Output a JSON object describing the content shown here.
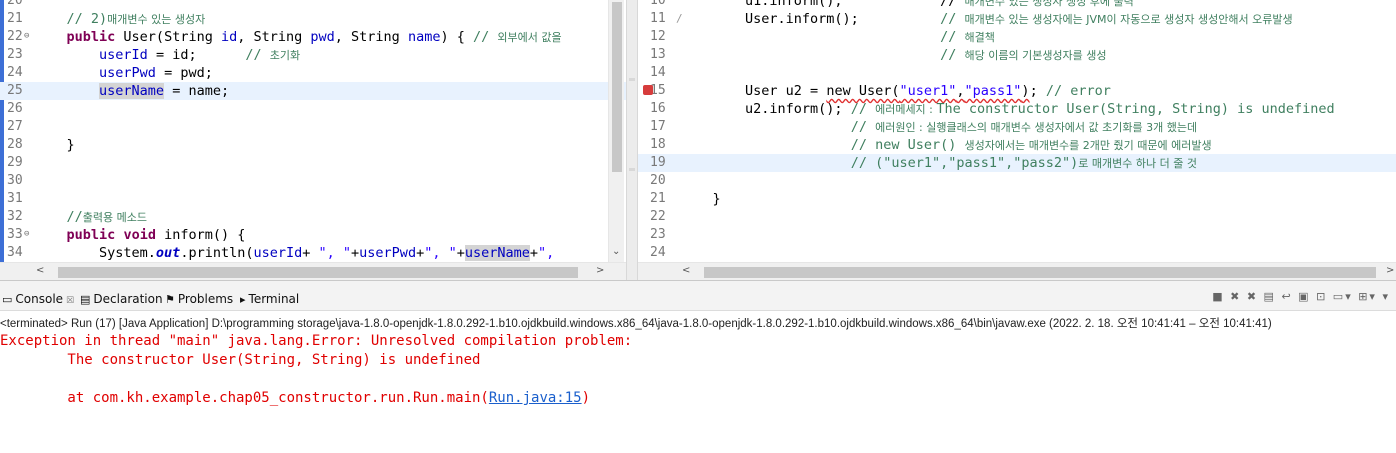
{
  "editor_left": {
    "lines": [
      {
        "n": "20",
        "fold": "",
        "segs": [
          {
            "t": "",
            "c": ""
          }
        ]
      },
      {
        "n": "21",
        "fold": "",
        "segs": [
          {
            "t": "    // 2)",
            "c": "cm"
          },
          {
            "t": "매개변수 있는 생성자",
            "c": "cm ko"
          }
        ]
      },
      {
        "n": "22",
        "fold": "⊖",
        "segs": [
          {
            "t": "    ",
            "c": ""
          },
          {
            "t": "public",
            "c": "kw"
          },
          {
            "t": " User(String ",
            "c": ""
          },
          {
            "t": "id",
            "c": "fld"
          },
          {
            "t": ", String ",
            "c": ""
          },
          {
            "t": "pwd",
            "c": "fld"
          },
          {
            "t": ", String ",
            "c": ""
          },
          {
            "t": "name",
            "c": "fld"
          },
          {
            "t": ") { ",
            "c": ""
          },
          {
            "t": "// ",
            "c": "cm"
          },
          {
            "t": "외부에서 값을",
            "c": "cm ko"
          }
        ]
      },
      {
        "n": "23",
        "fold": "",
        "segs": [
          {
            "t": "        ",
            "c": ""
          },
          {
            "t": "userId",
            "c": "fld"
          },
          {
            "t": " = id;      ",
            "c": ""
          },
          {
            "t": "// ",
            "c": "cm"
          },
          {
            "t": "초기화",
            "c": "cm ko"
          }
        ]
      },
      {
        "n": "24",
        "fold": "",
        "segs": [
          {
            "t": "        ",
            "c": ""
          },
          {
            "t": "userPwd",
            "c": "fld"
          },
          {
            "t": " = pwd;",
            "c": ""
          }
        ]
      },
      {
        "n": "25",
        "fold": "",
        "hl": true,
        "segs": [
          {
            "t": "        ",
            "c": ""
          },
          {
            "t": "userName",
            "c": "fld occ"
          },
          {
            "t": " = name;",
            "c": ""
          }
        ]
      },
      {
        "n": "26",
        "fold": "",
        "segs": [
          {
            "t": "",
            "c": ""
          }
        ]
      },
      {
        "n": "27",
        "fold": "",
        "segs": [
          {
            "t": "",
            "c": ""
          }
        ]
      },
      {
        "n": "28",
        "fold": "",
        "segs": [
          {
            "t": "    }",
            "c": ""
          }
        ]
      },
      {
        "n": "29",
        "fold": "",
        "segs": [
          {
            "t": "",
            "c": ""
          }
        ]
      },
      {
        "n": "30",
        "fold": "",
        "segs": [
          {
            "t": "",
            "c": ""
          }
        ]
      },
      {
        "n": "31",
        "fold": "",
        "segs": [
          {
            "t": "",
            "c": ""
          }
        ]
      },
      {
        "n": "32",
        "fold": "",
        "segs": [
          {
            "t": "    //",
            "c": "cm"
          },
          {
            "t": "출력용 메소드",
            "c": "cm ko"
          }
        ]
      },
      {
        "n": "33",
        "fold": "⊖",
        "segs": [
          {
            "t": "    ",
            "c": ""
          },
          {
            "t": "public",
            "c": "kw"
          },
          {
            "t": " ",
            "c": ""
          },
          {
            "t": "void",
            "c": "kw"
          },
          {
            "t": " inform() {",
            "c": ""
          }
        ]
      },
      {
        "n": "34",
        "fold": "",
        "segs": [
          {
            "t": "        System.",
            "c": ""
          },
          {
            "t": "out",
            "c": "stat"
          },
          {
            "t": ".println(",
            "c": ""
          },
          {
            "t": "userId",
            "c": "fld"
          },
          {
            "t": "+ ",
            "c": ""
          },
          {
            "t": "\", \"",
            "c": "st"
          },
          {
            "t": "+",
            "c": ""
          },
          {
            "t": "userPwd",
            "c": "fld"
          },
          {
            "t": "+",
            "c": ""
          },
          {
            "t": "\", \"",
            "c": "st"
          },
          {
            "t": "+",
            "c": ""
          },
          {
            "t": "userName",
            "c": "fld occ"
          },
          {
            "t": "+",
            "c": ""
          },
          {
            "t": "\",",
            "c": "st"
          }
        ]
      }
    ]
  },
  "editor_right": {
    "lines": [
      {
        "n": "10",
        "segs": [
          {
            "t": "        u1.inform();            // ",
            "c": ""
          },
          {
            "t": "매개변수 있는 생성자 생성 후에 출력",
            "c": "cm ko"
          }
        ]
      },
      {
        "n": "11",
        "mark": "/",
        "segs": [
          {
            "t": "        User.inform();          ",
            "c": ""
          },
          {
            "t": "// ",
            "c": "cm"
          },
          {
            "t": "매개변수 있는 생성자에는 JVM이 자동으로 생성자 생성안해서 오류발생",
            "c": "cm ko"
          }
        ]
      },
      {
        "n": "12",
        "segs": [
          {
            "t": "                                ",
            "c": ""
          },
          {
            "t": "// ",
            "c": "cm"
          },
          {
            "t": "해결책",
            "c": "cm ko"
          }
        ]
      },
      {
        "n": "13",
        "segs": [
          {
            "t": "                                ",
            "c": ""
          },
          {
            "t": "// ",
            "c": "cm"
          },
          {
            "t": "해당 이름의 기본생성자를 생성",
            "c": "cm ko"
          }
        ]
      },
      {
        "n": "14",
        "segs": [
          {
            "t": "",
            "c": ""
          }
        ]
      },
      {
        "n": "15",
        "err": true,
        "segs": [
          {
            "t": "        User u2 = ",
            "c": ""
          },
          {
            "t": "new User(",
            "c": "sq"
          },
          {
            "t": "\"user1\"",
            "c": "st sq"
          },
          {
            "t": ",",
            "c": "sq"
          },
          {
            "t": "\"pass1\"",
            "c": "st sq"
          },
          {
            "t": ")",
            "c": "sq"
          },
          {
            "t": "; ",
            "c": ""
          },
          {
            "t": "// error",
            "c": "cm"
          }
        ]
      },
      {
        "n": "16",
        "segs": [
          {
            "t": "        u2.inform(); ",
            "c": ""
          },
          {
            "t": "// ",
            "c": "cm"
          },
          {
            "t": "에러메세지 : ",
            "c": "cm ko"
          },
          {
            "t": "The constructor User(String, String) is undefined",
            "c": "cm"
          }
        ]
      },
      {
        "n": "17",
        "segs": [
          {
            "t": "                     ",
            "c": ""
          },
          {
            "t": "// ",
            "c": "cm"
          },
          {
            "t": "에러원인 : 실행클래스의 매개변수 생성자에서 값 초기화를 3개 했는데",
            "c": "cm ko"
          }
        ]
      },
      {
        "n": "18",
        "segs": [
          {
            "t": "                     ",
            "c": ""
          },
          {
            "t": "// new User() ",
            "c": "cm"
          },
          {
            "t": "생성자에서는 매개변수를 2개만 줬기 때문에 에러발생",
            "c": "cm ko"
          }
        ]
      },
      {
        "n": "19",
        "hl": true,
        "segs": [
          {
            "t": "                     ",
            "c": ""
          },
          {
            "t": "// (\"user1\",\"pass1\",\"pass2\")",
            "c": "cm"
          },
          {
            "t": "로 매개변수 하나 더 줄 것",
            "c": "cm ko"
          }
        ]
      },
      {
        "n": "20",
        "segs": [
          {
            "t": "",
            "c": ""
          }
        ]
      },
      {
        "n": "21",
        "segs": [
          {
            "t": "    }",
            "c": ""
          }
        ]
      },
      {
        "n": "22",
        "segs": [
          {
            "t": "",
            "c": ""
          }
        ]
      },
      {
        "n": "23",
        "segs": [
          {
            "t": "",
            "c": ""
          }
        ]
      },
      {
        "n": "24",
        "segs": [
          {
            "t": "",
            "c": ""
          }
        ]
      }
    ]
  },
  "panel": {
    "tabs": [
      {
        "icon": "▭",
        "label": "Console",
        "close": "☒",
        "active": true
      },
      {
        "icon": "▤",
        "label": "Declaration"
      },
      {
        "icon": "⚑",
        "label": "Problems"
      },
      {
        "icon": "▸",
        "label": "Terminal"
      }
    ],
    "toolbar_icons": [
      "stop-icon",
      "remove-launch-icon",
      "remove-all-icon",
      "scroll-lock-icon",
      "word-wrap-icon",
      "show-on-output-icon",
      "pin-console-icon",
      "display-console-icon",
      "new-console-icon",
      "view-menu-icon"
    ],
    "console_header": "<terminated> Run (17) [Java Application] D:\\programming storage\\java-1.8.0-openjdk-1.8.0.292-1.b10.ojdkbuild.windows.x86_64\\java-1.8.0-openjdk-1.8.0.292-1.b10.ojdkbuild.windows.x86_64\\bin\\javaw.exe  (2022. 2. 18. 오전 10:41:41 – 오전 10:41:41)",
    "output": [
      {
        "text": "Exception in thread \"main\" java.lang.Error: Unresolved compilation problem: "
      },
      {
        "text": "\tThe constructor User(String, String) is undefined"
      },
      {
        "text": ""
      },
      {
        "text": "\tat com.kh.example.chap05_constructor.run.Run.main(",
        "link": "Run.java:15",
        "after": ")"
      }
    ]
  },
  "colors": {
    "keyword": "#7f0055",
    "comment": "#3f7f5f",
    "field": "#0000c0",
    "string": "#2a00ff",
    "error": "#e00000",
    "link": "#1a5fcc"
  }
}
